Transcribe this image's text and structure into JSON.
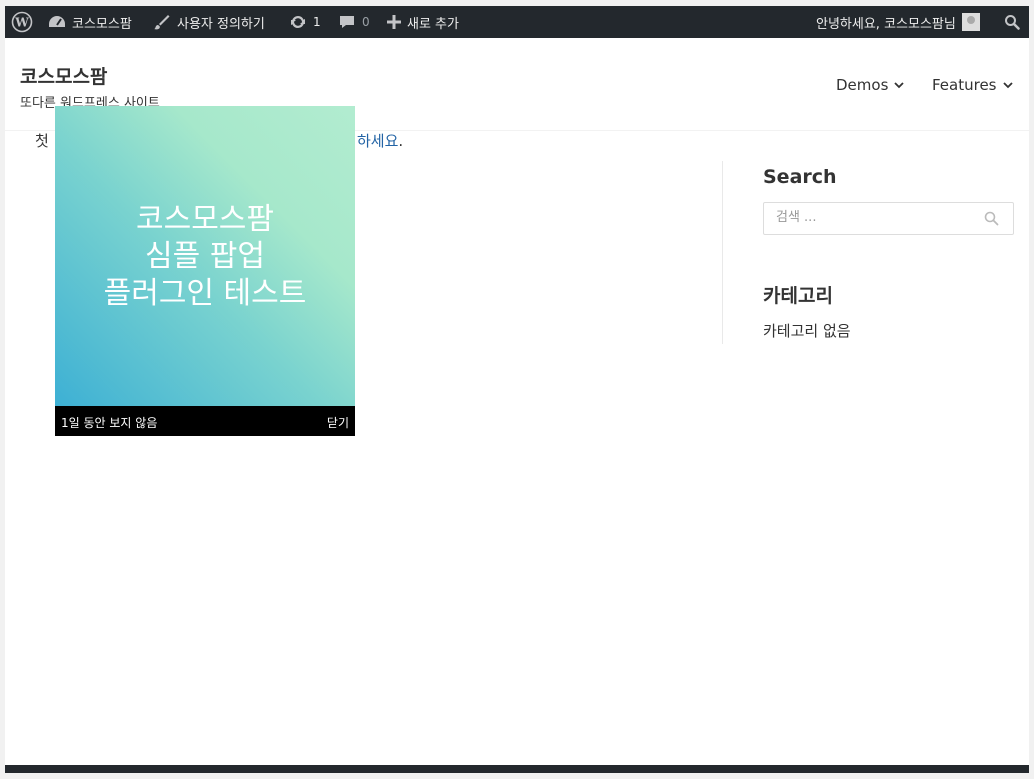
{
  "admin_bar": {
    "site_name": "코스모스팜",
    "customize": "사용자 정의하기",
    "updates_count": "1",
    "comments_count": "0",
    "new_label": "새로 추가",
    "greeting": "안녕하세요, 코스모스팜님"
  },
  "header": {
    "site_title": "코스모스팜",
    "site_description": "또다른 워드프레스 사이트",
    "nav": [
      {
        "label": "Demos"
      },
      {
        "label": "Features"
      }
    ]
  },
  "main": {
    "text_start": "첫",
    "link_text": "하세요",
    "text_end": "."
  },
  "sidebar": {
    "search_title": "Search",
    "search_placeholder": "검색 ...",
    "category_title": "카테고리",
    "category_empty": "카테고리 없음"
  },
  "popup": {
    "line1": "코스모스팜",
    "line2": "심플 팝업",
    "line3": "플러그인 테스트",
    "hide_day_label": "1일 동안 보지 않음",
    "close_label": "닫기"
  },
  "colors": {
    "admin_bar": "#23282d",
    "link": "#2263a5"
  }
}
